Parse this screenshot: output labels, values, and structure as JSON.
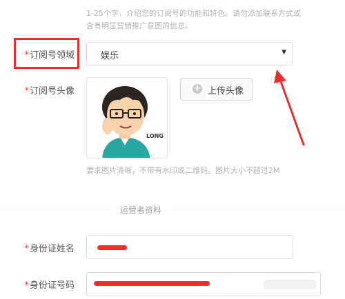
{
  "form": {
    "desc_help_line1": "1-25个字，介绍您的订阅号的功能和特色。请勿添加联系方式或",
    "desc_help_line2": "含有明显营销推广意图的信息。",
    "required_mark": "*",
    "domain_label": "订阅号领域",
    "domain_value": "娱乐",
    "avatar_label": "订阅号头像",
    "avatar_caption": "LONG",
    "upload_label": "上传头像",
    "avatar_help": "要求图片清晰，不带有水印或二维码。图片大小不超过2M"
  },
  "operator": {
    "section_title": "运营者资料",
    "name_label": "身份证姓名",
    "id_label": "身份证号码"
  },
  "colors": {
    "required": "#e64545",
    "annotation_red": "#e53030",
    "redaction_red": "#ff2a2a"
  }
}
